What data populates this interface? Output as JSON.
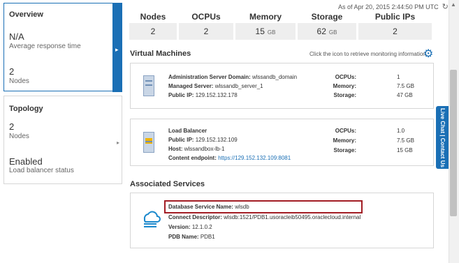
{
  "left": {
    "overview": {
      "title": "Overview",
      "response_value": "N/A",
      "response_label": "Average response time",
      "nodes_value": "2",
      "nodes_label": "Nodes"
    },
    "topology": {
      "title": "Topology",
      "nodes_value": "2",
      "nodes_label": "Nodes",
      "lb_value": "Enabled",
      "lb_label": "Load balancer status"
    }
  },
  "timestamp": "As of Apr 20, 2015 2:44:50 PM UTC",
  "stats": [
    {
      "label": "Nodes",
      "value": "2",
      "unit": ""
    },
    {
      "label": "OCPUs",
      "value": "2",
      "unit": ""
    },
    {
      "label": "Memory",
      "value": "15",
      "unit": "GB"
    },
    {
      "label": "Storage",
      "value": "62",
      "unit": "GB"
    },
    {
      "label": "Public IPs",
      "value": "2",
      "unit": ""
    }
  ],
  "vm_section": {
    "title": "Virtual Machines",
    "monitor_hint": "Click the icon to retrieve monitoring information"
  },
  "vm1": {
    "rows": [
      {
        "label": "Administration Server Domain:",
        "value": "wlssandb_domain"
      },
      {
        "label": "Managed Server:",
        "value": "wlssandb_server_1"
      },
      {
        "label": "Public IP:",
        "value": "129.152.132.178"
      }
    ],
    "specs": [
      {
        "label": "OCPUs:",
        "value": "1"
      },
      {
        "label": "Memory:",
        "value": "7.5 GB"
      },
      {
        "label": "Storage:",
        "value": "47 GB"
      }
    ]
  },
  "vm2": {
    "title": "Load Balancer",
    "rows": [
      {
        "label": "Public IP:",
        "value": "129.152.132.109"
      },
      {
        "label": "Host:",
        "value": "wlssandbox-lb-1"
      },
      {
        "label": "Content endpoint:",
        "value": "https://129.152.132.109:8081"
      }
    ],
    "specs": [
      {
        "label": "OCPUs:",
        "value": "1.0"
      },
      {
        "label": "Memory:",
        "value": "7.5 GB"
      },
      {
        "label": "Storage:",
        "value": "15 GB"
      }
    ]
  },
  "associated": {
    "title": "Associated Services",
    "rows": [
      {
        "label": "Database Service Name:",
        "value": "wlsdb"
      },
      {
        "label": "Connect Descriptor:",
        "value": "wlsdb:1521/PDB1.usoracleib50495.oraclecloud.internal"
      },
      {
        "label": "Version:",
        "value": "12.1.0.2"
      },
      {
        "label": "PDB Name:",
        "value": "PDB1"
      }
    ]
  },
  "live_chat": "Live Chat | Contact Us",
  "colors": {
    "accent": "#1a6fb5",
    "highlight": "#a21d24"
  }
}
